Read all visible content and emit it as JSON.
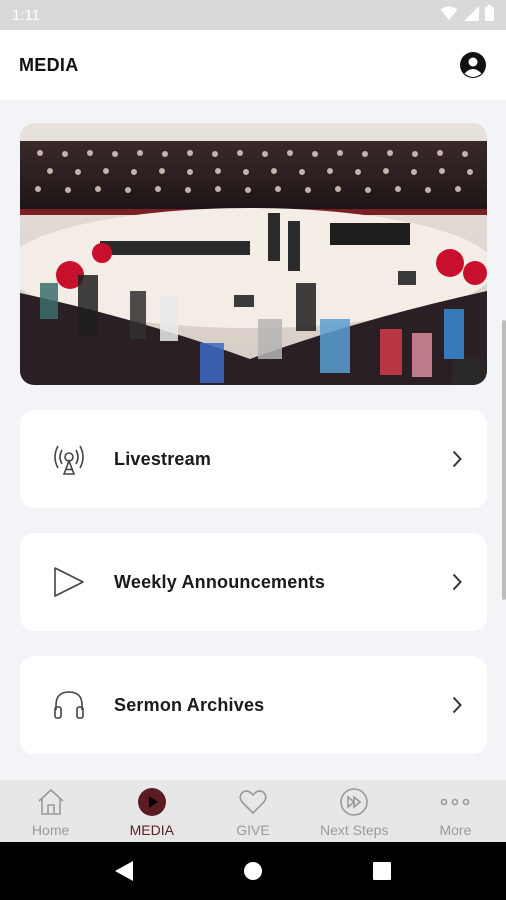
{
  "status_bar": {
    "time": "1:11",
    "icons": [
      "wifi-icon",
      "signal-icon",
      "battery-icon"
    ]
  },
  "header": {
    "title": "MEDIA",
    "profile_icon": "user-circle-icon"
  },
  "hero": {
    "image": "choir-sanctuary-photo"
  },
  "menu": [
    {
      "label": "Livestream",
      "icon": "broadcast-tower-icon"
    },
    {
      "label": "Weekly Announcements",
      "icon": "play-outline-icon"
    },
    {
      "label": "Sermon Archives",
      "icon": "headphones-icon"
    }
  ],
  "tabs": [
    {
      "label": "Home",
      "icon": "home-icon",
      "active": false
    },
    {
      "label": "MEDIA",
      "icon": "play-circle-icon",
      "active": true
    },
    {
      "label": "GIVE",
      "icon": "heart-icon",
      "active": false
    },
    {
      "label": "Next Steps",
      "icon": "fast-forward-circle-icon",
      "active": false
    },
    {
      "label": "More",
      "icon": "more-dots-icon",
      "active": false
    }
  ],
  "colors": {
    "accent": "#5b1d22",
    "inactive": "#9a9a9a",
    "background": "#f3f4f8",
    "card": "#ffffff"
  }
}
